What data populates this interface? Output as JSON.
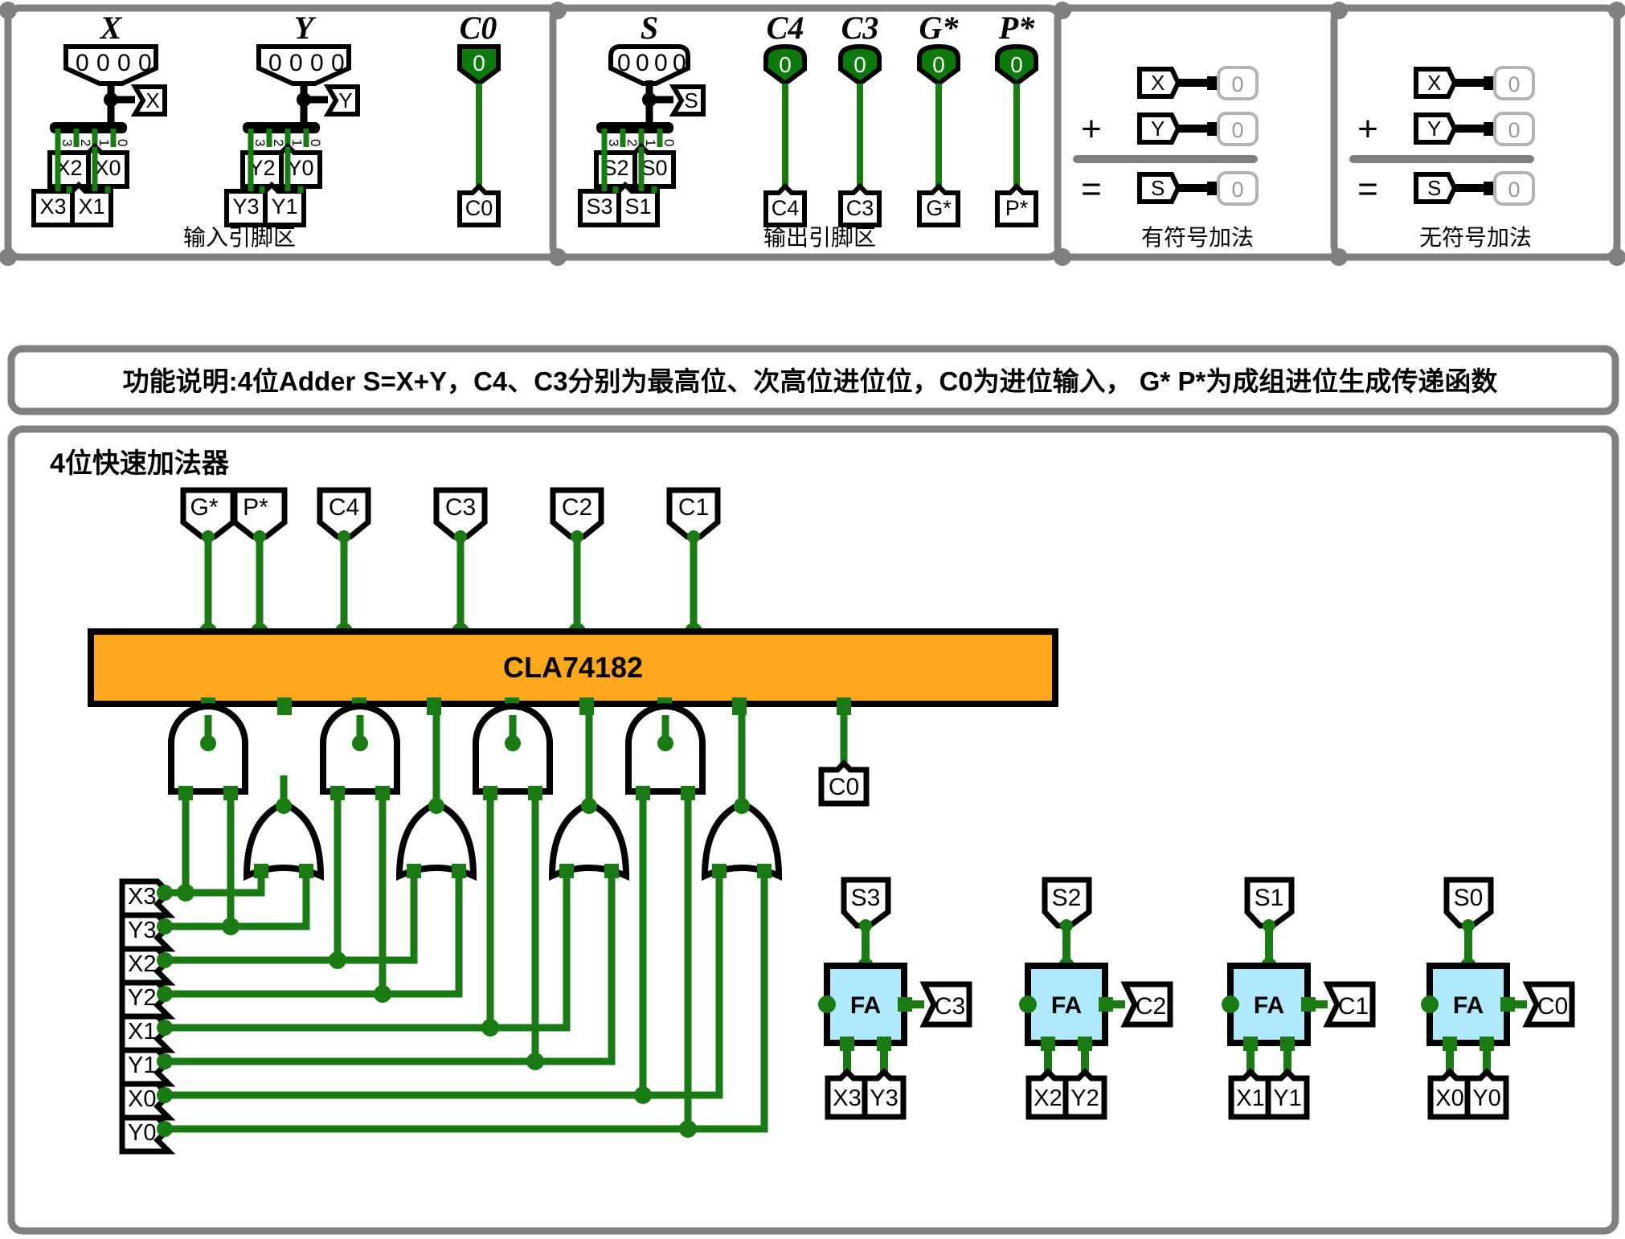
{
  "frame": {
    "border_color": "#808080",
    "wire_color": "#1a7a14",
    "led_on_color": "#0d7a0d",
    "cla_fill": "#FFA81E",
    "fa_fill": "#AFE9FB"
  },
  "panels": {
    "input_area": {
      "caption": "输入引脚区",
      "groups": [
        {
          "title": "X",
          "display_bits": [
            "0",
            "0",
            "0",
            "0"
          ],
          "tunnel_label": "X",
          "splitter_indices": [
            "3",
            "2",
            "1",
            "0"
          ],
          "pins_upper": [
            "X2",
            "X0"
          ],
          "pins_lower": [
            "X3",
            "X1"
          ]
        },
        {
          "title": "Y",
          "display_bits": [
            "0",
            "0",
            "0",
            "0"
          ],
          "tunnel_label": "Y",
          "splitter_indices": [
            "3",
            "2",
            "1",
            "0"
          ],
          "pins_upper": [
            "Y2",
            "Y0"
          ],
          "pins_lower": [
            "Y3",
            "Y1"
          ]
        }
      ],
      "carry": {
        "title": "C0",
        "led_value": "0",
        "pin_label": "C0"
      }
    },
    "output_area": {
      "caption": "输出引脚区",
      "sum_group": {
        "title": "S",
        "display_bits": [
          "0",
          "0",
          "0",
          "0"
        ],
        "tunnel_label": "S",
        "splitter_indices": [
          "3",
          "2",
          "1",
          "0"
        ],
        "pins_upper": [
          "S2",
          "S0"
        ],
        "pins_lower": [
          "S3",
          "S1"
        ]
      },
      "leds": [
        {
          "title": "C4",
          "led_value": "0",
          "pin_label": "C4"
        },
        {
          "title": "C3",
          "led_value": "0",
          "pin_label": "C3"
        },
        {
          "title": "G*",
          "led_value": "0",
          "pin_label": "G*"
        },
        {
          "title": "P*",
          "led_value": "0",
          "pin_label": "P*"
        }
      ]
    },
    "signed_add": {
      "caption": "有符号加法",
      "rows": [
        {
          "op": "",
          "tunnel": "X",
          "value": "0"
        },
        {
          "op": "+",
          "tunnel": "Y",
          "value": "0"
        },
        {
          "op": "=",
          "tunnel": "S",
          "value": "0"
        }
      ]
    },
    "unsigned_add": {
      "caption": "无符号加法",
      "rows": [
        {
          "op": "",
          "tunnel": "X",
          "value": "0"
        },
        {
          "op": "+",
          "tunnel": "Y",
          "value": "0"
        },
        {
          "op": "=",
          "tunnel": "S",
          "value": "0"
        }
      ]
    }
  },
  "description_bar": {
    "text": "功能说明:4位Adder  S=X+Y，C4、C3分别为最高位、次高位进位位，C0为进位输入， G* P*为成组进位生成传递函数"
  },
  "circuit": {
    "title": "4位快速加法器",
    "cla_block": {
      "label": "CLA74182"
    },
    "top_pins": [
      "G*",
      "P*",
      "C4",
      "C3",
      "C2",
      "C1"
    ],
    "carry_in_pin": "C0",
    "input_pins": [
      "X3",
      "Y3",
      "X2",
      "Y2",
      "X1",
      "Y1",
      "X0",
      "Y0"
    ],
    "gates": {
      "and_label": "AND",
      "or_label": "OR",
      "and_count": 4,
      "or_count": 4
    },
    "full_adders": [
      {
        "name": "FA",
        "sum_pin": "S3",
        "carry_pin": "C3",
        "inputs": [
          "X3",
          "Y3"
        ]
      },
      {
        "name": "FA",
        "sum_pin": "S2",
        "carry_pin": "C2",
        "inputs": [
          "X2",
          "Y2"
        ]
      },
      {
        "name": "FA",
        "sum_pin": "S1",
        "carry_pin": "C1",
        "inputs": [
          "X1",
          "Y1"
        ]
      },
      {
        "name": "FA",
        "sum_pin": "S0",
        "carry_pin": "C0",
        "inputs": [
          "X0",
          "Y0"
        ]
      }
    ]
  }
}
